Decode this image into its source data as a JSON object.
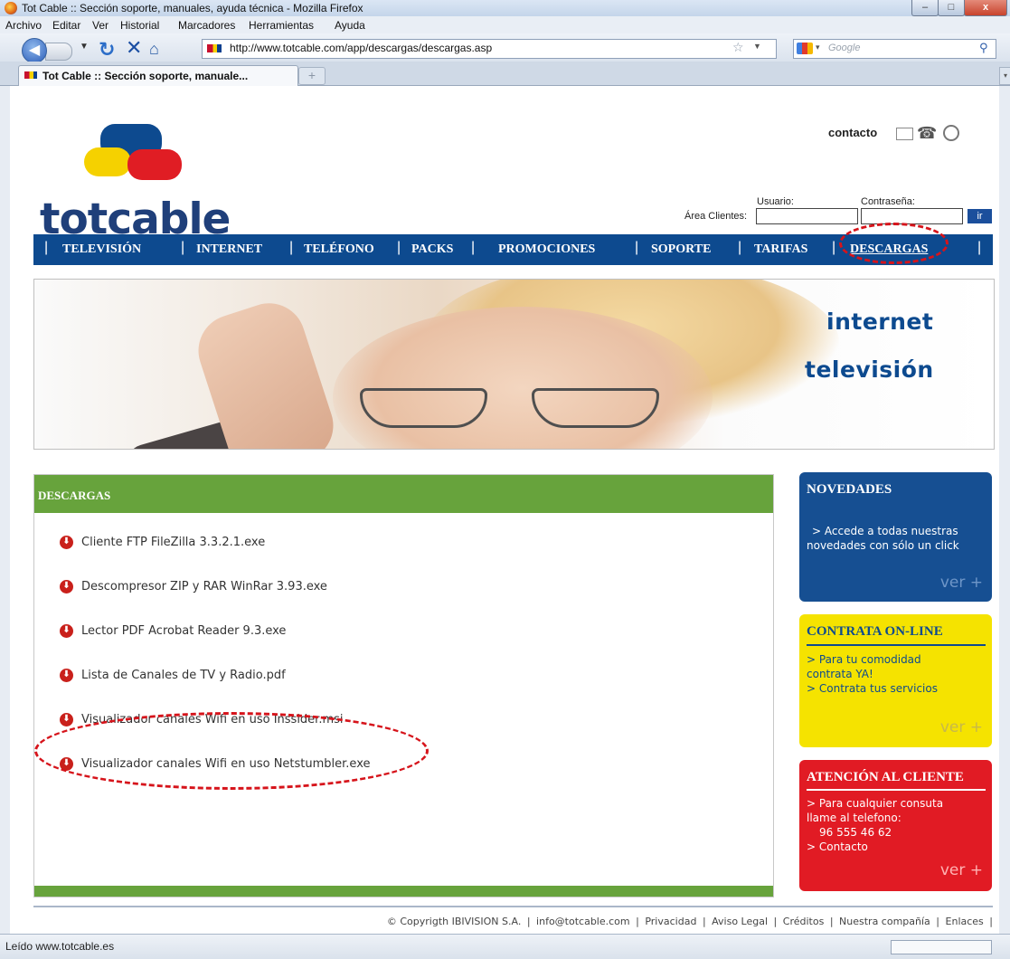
{
  "window": {
    "title": "Tot Cable :: Sección soporte, manuales, ayuda técnica - Mozilla Firefox",
    "min": "–",
    "max": "□",
    "close": "x"
  },
  "menubar": [
    "Archivo",
    "Editar",
    "Ver",
    "Historial",
    "Marcadores",
    "Herramientas",
    "Ayuda"
  ],
  "navbar": {
    "url": "http://www.totcable.com/app/descargas/descargas.asp",
    "search_placeholder": "Google"
  },
  "tab": {
    "label": "Tot Cable :: Sección soporte, manuale...",
    "new_tab": "+"
  },
  "header": {
    "logo": "totcable",
    "contacto": "contacto",
    "user_label": "Usuario:",
    "pass_label": "Contraseña:",
    "area_label": "Área Clientes:",
    "go_button": "ir"
  },
  "mainnav": [
    "TELEVISIÓN",
    "INTERNET",
    "TELÉFONO",
    "PACKS",
    "PROMOCIONES",
    "SOPORTE",
    "TARIFAS",
    "DESCARGAS"
  ],
  "banner": {
    "line1": "internet",
    "line2": "televisión"
  },
  "downloads": {
    "title": "DESCARGAS",
    "items": [
      "Cliente FTP FileZilla 3.3.2.1.exe",
      "Descompresor ZIP y RAR WinRar 3.93.exe",
      "Lector PDF Acrobat Reader 9.3.exe",
      "Lista de Canales de TV y Radio.pdf",
      "Visualizador canales Wifi en uso Inssider.msi",
      "Visualizador canales Wifi en uso Netstumbler.exe"
    ]
  },
  "sidebar": {
    "novedades": {
      "title": "NOVEDADES",
      "line1": "> Accede a todas nuestras",
      "line2": "novedades con sólo un click",
      "more": "ver +"
    },
    "contrata": {
      "title": "CONTRATA ON-LINE",
      "line1": "> Para tu comodidad",
      "line2": "contrata YA!",
      "line3": "> Contrata tus servicios",
      "more": "ver +"
    },
    "atencion": {
      "title": "ATENCIÓN AL CLIENTE",
      "line1": "> Para cualquier consuta",
      "line2": "llame al telefono:",
      "line3": "96 555 46 62",
      "line4": "> Contacto",
      "more": "ver +"
    }
  },
  "footer": {
    "copyright": "© Copyrigth IBIVISION S.A.",
    "links": [
      "info@totcable.com",
      "Privacidad",
      "Aviso Legal",
      "Créditos",
      "Nuestra compañía",
      "Enlaces"
    ]
  },
  "status": {
    "text": "Leído www.totcable.es"
  },
  "colors": {
    "nav_blue": "#0d4a8f",
    "green_header": "#67a33c",
    "novedades_blue": "#164f92",
    "contrata_yellow": "#f5e300",
    "atencion_red": "#e11b24",
    "annotation_red": "#d6141b"
  }
}
